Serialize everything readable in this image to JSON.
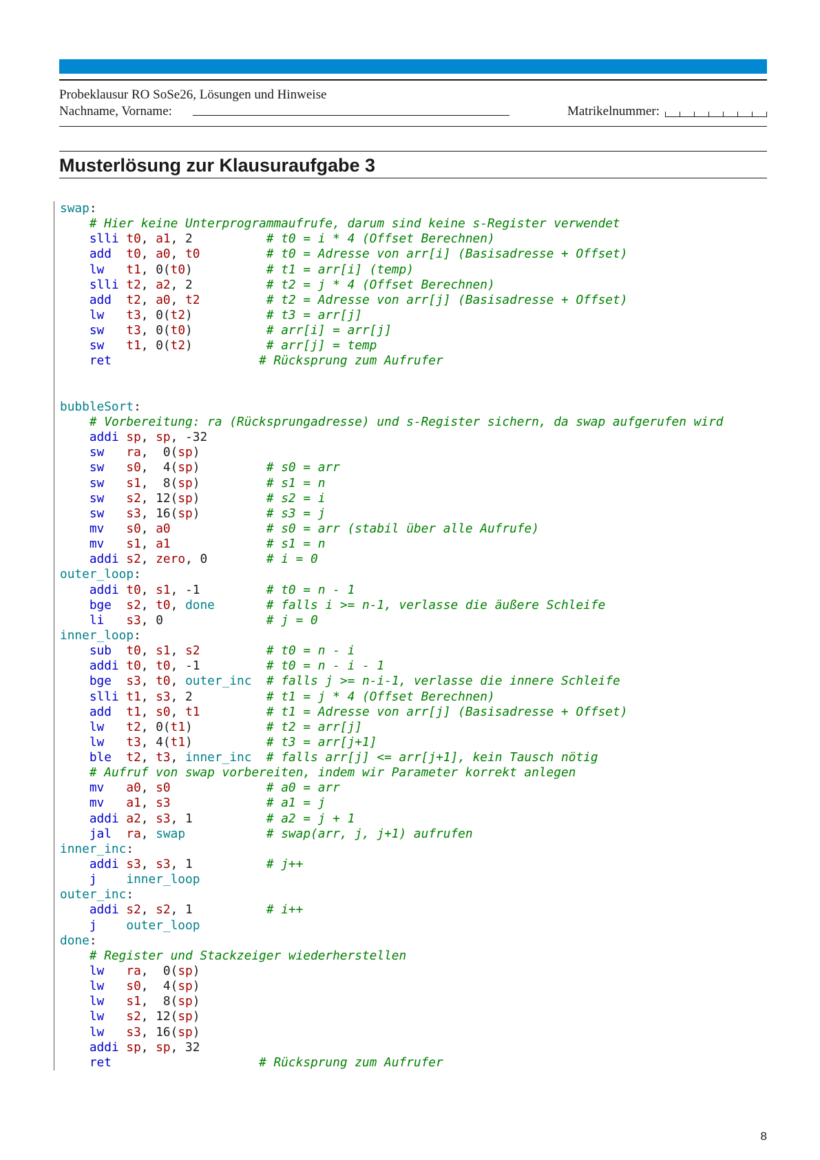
{
  "header": {
    "title": "Probeklausur RO SoSe26, Lösungen und Hinweise",
    "name_label": "Nachname, Vorname:",
    "matrikel_label": "Matrikelnummer:"
  },
  "section_title": "Musterlösung zur Klausuraufgabe 3",
  "page_number": "8",
  "colors": {
    "accent_bar": "#0288d1",
    "label": "#00808a",
    "instruction": "#0000cc",
    "register": "#a00000",
    "comment": "#008000"
  },
  "code_lines": [
    [
      [
        "l",
        "swap"
      ],
      [
        "p",
        ":"
      ]
    ],
    [
      [
        "p",
        "    "
      ],
      [
        "c",
        "# Hier keine Unterprogrammaufrufe, darum sind keine s-Register verwendet"
      ]
    ],
    [
      [
        "p",
        "    "
      ],
      [
        "i",
        "slli"
      ],
      [
        "p",
        " "
      ],
      [
        "r",
        "t0"
      ],
      [
        "p",
        ", "
      ],
      [
        "r",
        "a1"
      ],
      [
        "p",
        ", 2          "
      ],
      [
        "c",
        "# t0 = i * 4 (Offset Berechnen)"
      ]
    ],
    [
      [
        "p",
        "    "
      ],
      [
        "i",
        "add"
      ],
      [
        "p",
        "  "
      ],
      [
        "r",
        "t0"
      ],
      [
        "p",
        ", "
      ],
      [
        "r",
        "a0"
      ],
      [
        "p",
        ", "
      ],
      [
        "r",
        "t0"
      ],
      [
        "p",
        "         "
      ],
      [
        "c",
        "# t0 = Adresse von arr[i] (Basisadresse + Offset)"
      ]
    ],
    [
      [
        "p",
        "    "
      ],
      [
        "i",
        "lw"
      ],
      [
        "p",
        "   "
      ],
      [
        "r",
        "t1"
      ],
      [
        "p",
        ", 0("
      ],
      [
        "r",
        "t0"
      ],
      [
        "p",
        ")          "
      ],
      [
        "c",
        "# t1 = arr[i] (temp)"
      ]
    ],
    [
      [
        "p",
        "    "
      ],
      [
        "i",
        "slli"
      ],
      [
        "p",
        " "
      ],
      [
        "r",
        "t2"
      ],
      [
        "p",
        ", "
      ],
      [
        "r",
        "a2"
      ],
      [
        "p",
        ", 2          "
      ],
      [
        "c",
        "# t2 = j * 4 (Offset Berechnen)"
      ]
    ],
    [
      [
        "p",
        "    "
      ],
      [
        "i",
        "add"
      ],
      [
        "p",
        "  "
      ],
      [
        "r",
        "t2"
      ],
      [
        "p",
        ", "
      ],
      [
        "r",
        "a0"
      ],
      [
        "p",
        ", "
      ],
      [
        "r",
        "t2"
      ],
      [
        "p",
        "         "
      ],
      [
        "c",
        "# t2 = Adresse von arr[j] (Basisadresse + Offset)"
      ]
    ],
    [
      [
        "p",
        "    "
      ],
      [
        "i",
        "lw"
      ],
      [
        "p",
        "   "
      ],
      [
        "r",
        "t3"
      ],
      [
        "p",
        ", 0("
      ],
      [
        "r",
        "t2"
      ],
      [
        "p",
        ")          "
      ],
      [
        "c",
        "# t3 = arr[j]"
      ]
    ],
    [
      [
        "p",
        "    "
      ],
      [
        "i",
        "sw"
      ],
      [
        "p",
        "   "
      ],
      [
        "r",
        "t3"
      ],
      [
        "p",
        ", 0("
      ],
      [
        "r",
        "t0"
      ],
      [
        "p",
        ")          "
      ],
      [
        "c",
        "# arr[i] = arr[j]"
      ]
    ],
    [
      [
        "p",
        "    "
      ],
      [
        "i",
        "sw"
      ],
      [
        "p",
        "   "
      ],
      [
        "r",
        "t1"
      ],
      [
        "p",
        ", 0("
      ],
      [
        "r",
        "t2"
      ],
      [
        "p",
        ")          "
      ],
      [
        "c",
        "# arr[j] = temp"
      ]
    ],
    [
      [
        "p",
        "    "
      ],
      [
        "i",
        "ret"
      ],
      [
        "p",
        "                    "
      ],
      [
        "c",
        "# Rücksprung zum Aufrufer"
      ]
    ],
    [],
    [],
    [
      [
        "l",
        "bubbleSort"
      ],
      [
        "p",
        ":"
      ]
    ],
    [
      [
        "p",
        "    "
      ],
      [
        "c",
        "# Vorbereitung: ra (Rücksprungadresse) und s-Register sichern, da swap aufgerufen wird"
      ]
    ],
    [
      [
        "p",
        "    "
      ],
      [
        "i",
        "addi"
      ],
      [
        "p",
        " "
      ],
      [
        "r",
        "sp"
      ],
      [
        "p",
        ", "
      ],
      [
        "r",
        "sp"
      ],
      [
        "p",
        ", -32"
      ]
    ],
    [
      [
        "p",
        "    "
      ],
      [
        "i",
        "sw"
      ],
      [
        "p",
        "   "
      ],
      [
        "r",
        "ra"
      ],
      [
        "p",
        ",  0("
      ],
      [
        "r",
        "sp"
      ],
      [
        "p",
        ")"
      ]
    ],
    [
      [
        "p",
        "    "
      ],
      [
        "i",
        "sw"
      ],
      [
        "p",
        "   "
      ],
      [
        "r",
        "s0"
      ],
      [
        "p",
        ",  4("
      ],
      [
        "r",
        "sp"
      ],
      [
        "p",
        ")         "
      ],
      [
        "c",
        "# s0 = arr"
      ]
    ],
    [
      [
        "p",
        "    "
      ],
      [
        "i",
        "sw"
      ],
      [
        "p",
        "   "
      ],
      [
        "r",
        "s1"
      ],
      [
        "p",
        ",  8("
      ],
      [
        "r",
        "sp"
      ],
      [
        "p",
        ")         "
      ],
      [
        "c",
        "# s1 = n"
      ]
    ],
    [
      [
        "p",
        "    "
      ],
      [
        "i",
        "sw"
      ],
      [
        "p",
        "   "
      ],
      [
        "r",
        "s2"
      ],
      [
        "p",
        ", 12("
      ],
      [
        "r",
        "sp"
      ],
      [
        "p",
        ")         "
      ],
      [
        "c",
        "# s2 = i"
      ]
    ],
    [
      [
        "p",
        "    "
      ],
      [
        "i",
        "sw"
      ],
      [
        "p",
        "   "
      ],
      [
        "r",
        "s3"
      ],
      [
        "p",
        ", 16("
      ],
      [
        "r",
        "sp"
      ],
      [
        "p",
        ")         "
      ],
      [
        "c",
        "# s3 = j"
      ]
    ],
    [
      [
        "p",
        "    "
      ],
      [
        "i",
        "mv"
      ],
      [
        "p",
        "   "
      ],
      [
        "r",
        "s0"
      ],
      [
        "p",
        ", "
      ],
      [
        "r",
        "a0"
      ],
      [
        "p",
        "             "
      ],
      [
        "c",
        "# s0 = arr (stabil über alle Aufrufe)"
      ]
    ],
    [
      [
        "p",
        "    "
      ],
      [
        "i",
        "mv"
      ],
      [
        "p",
        "   "
      ],
      [
        "r",
        "s1"
      ],
      [
        "p",
        ", "
      ],
      [
        "r",
        "a1"
      ],
      [
        "p",
        "             "
      ],
      [
        "c",
        "# s1 = n"
      ]
    ],
    [
      [
        "p",
        "    "
      ],
      [
        "i",
        "addi"
      ],
      [
        "p",
        " "
      ],
      [
        "r",
        "s2"
      ],
      [
        "p",
        ", "
      ],
      [
        "r",
        "zero"
      ],
      [
        "p",
        ", 0        "
      ],
      [
        "c",
        "# i = 0"
      ]
    ],
    [
      [
        "l",
        "outer_loop"
      ],
      [
        "p",
        ":"
      ]
    ],
    [
      [
        "p",
        "    "
      ],
      [
        "i",
        "addi"
      ],
      [
        "p",
        " "
      ],
      [
        "r",
        "t0"
      ],
      [
        "p",
        ", "
      ],
      [
        "r",
        "s1"
      ],
      [
        "p",
        ", -1         "
      ],
      [
        "c",
        "# t0 = n - 1"
      ]
    ],
    [
      [
        "p",
        "    "
      ],
      [
        "i",
        "bge"
      ],
      [
        "p",
        "  "
      ],
      [
        "r",
        "s2"
      ],
      [
        "p",
        ", "
      ],
      [
        "r",
        "t0"
      ],
      [
        "p",
        ", "
      ],
      [
        "l",
        "done"
      ],
      [
        "p",
        "       "
      ],
      [
        "c",
        "# falls i >= n-1, verlasse die äußere Schleife"
      ]
    ],
    [
      [
        "p",
        "    "
      ],
      [
        "i",
        "li"
      ],
      [
        "p",
        "   "
      ],
      [
        "r",
        "s3"
      ],
      [
        "p",
        ", 0              "
      ],
      [
        "c",
        "# j = 0"
      ]
    ],
    [
      [
        "l",
        "inner_loop"
      ],
      [
        "p",
        ":"
      ]
    ],
    [
      [
        "p",
        "    "
      ],
      [
        "i",
        "sub"
      ],
      [
        "p",
        "  "
      ],
      [
        "r",
        "t0"
      ],
      [
        "p",
        ", "
      ],
      [
        "r",
        "s1"
      ],
      [
        "p",
        ", "
      ],
      [
        "r",
        "s2"
      ],
      [
        "p",
        "         "
      ],
      [
        "c",
        "# t0 = n - i"
      ]
    ],
    [
      [
        "p",
        "    "
      ],
      [
        "i",
        "addi"
      ],
      [
        "p",
        " "
      ],
      [
        "r",
        "t0"
      ],
      [
        "p",
        ", "
      ],
      [
        "r",
        "t0"
      ],
      [
        "p",
        ", -1         "
      ],
      [
        "c",
        "# t0 = n - i - 1"
      ]
    ],
    [
      [
        "p",
        "    "
      ],
      [
        "i",
        "bge"
      ],
      [
        "p",
        "  "
      ],
      [
        "r",
        "s3"
      ],
      [
        "p",
        ", "
      ],
      [
        "r",
        "t0"
      ],
      [
        "p",
        ", "
      ],
      [
        "l",
        "outer_inc"
      ],
      [
        "p",
        "  "
      ],
      [
        "c",
        "# falls j >= n-i-1, verlasse die innere Schleife"
      ]
    ],
    [
      [
        "p",
        "    "
      ],
      [
        "i",
        "slli"
      ],
      [
        "p",
        " "
      ],
      [
        "r",
        "t1"
      ],
      [
        "p",
        ", "
      ],
      [
        "r",
        "s3"
      ],
      [
        "p",
        ", 2          "
      ],
      [
        "c",
        "# t1 = j * 4 (Offset Berechnen)"
      ]
    ],
    [
      [
        "p",
        "    "
      ],
      [
        "i",
        "add"
      ],
      [
        "p",
        "  "
      ],
      [
        "r",
        "t1"
      ],
      [
        "p",
        ", "
      ],
      [
        "r",
        "s0"
      ],
      [
        "p",
        ", "
      ],
      [
        "r",
        "t1"
      ],
      [
        "p",
        "         "
      ],
      [
        "c",
        "# t1 = Adresse von arr[j] (Basisadresse + Offset)"
      ]
    ],
    [
      [
        "p",
        "    "
      ],
      [
        "i",
        "lw"
      ],
      [
        "p",
        "   "
      ],
      [
        "r",
        "t2"
      ],
      [
        "p",
        ", 0("
      ],
      [
        "r",
        "t1"
      ],
      [
        "p",
        ")          "
      ],
      [
        "c",
        "# t2 = arr[j]"
      ]
    ],
    [
      [
        "p",
        "    "
      ],
      [
        "i",
        "lw"
      ],
      [
        "p",
        "   "
      ],
      [
        "r",
        "t3"
      ],
      [
        "p",
        ", 4("
      ],
      [
        "r",
        "t1"
      ],
      [
        "p",
        ")          "
      ],
      [
        "c",
        "# t3 = arr[j+1]"
      ]
    ],
    [
      [
        "p",
        "    "
      ],
      [
        "i",
        "ble"
      ],
      [
        "p",
        "  "
      ],
      [
        "r",
        "t2"
      ],
      [
        "p",
        ", "
      ],
      [
        "r",
        "t3"
      ],
      [
        "p",
        ", "
      ],
      [
        "l",
        "inner_inc"
      ],
      [
        "p",
        "  "
      ],
      [
        "c",
        "# falls arr[j] <= arr[j+1], kein Tausch nötig"
      ]
    ],
    [
      [
        "p",
        "    "
      ],
      [
        "c",
        "# Aufruf von swap vorbereiten, indem wir Parameter korrekt anlegen"
      ]
    ],
    [
      [
        "p",
        "    "
      ],
      [
        "i",
        "mv"
      ],
      [
        "p",
        "   "
      ],
      [
        "r",
        "a0"
      ],
      [
        "p",
        ", "
      ],
      [
        "r",
        "s0"
      ],
      [
        "p",
        "             "
      ],
      [
        "c",
        "# a0 = arr"
      ]
    ],
    [
      [
        "p",
        "    "
      ],
      [
        "i",
        "mv"
      ],
      [
        "p",
        "   "
      ],
      [
        "r",
        "a1"
      ],
      [
        "p",
        ", "
      ],
      [
        "r",
        "s3"
      ],
      [
        "p",
        "             "
      ],
      [
        "c",
        "# a1 = j"
      ]
    ],
    [
      [
        "p",
        "    "
      ],
      [
        "i",
        "addi"
      ],
      [
        "p",
        " "
      ],
      [
        "r",
        "a2"
      ],
      [
        "p",
        ", "
      ],
      [
        "r",
        "s3"
      ],
      [
        "p",
        ", 1          "
      ],
      [
        "c",
        "# a2 = j + 1"
      ]
    ],
    [
      [
        "p",
        "    "
      ],
      [
        "i",
        "jal"
      ],
      [
        "p",
        "  "
      ],
      [
        "r",
        "ra"
      ],
      [
        "p",
        ", "
      ],
      [
        "l",
        "swap"
      ],
      [
        "p",
        "           "
      ],
      [
        "c",
        "# swap(arr, j, j+1) aufrufen"
      ]
    ],
    [
      [
        "l",
        "inner_inc"
      ],
      [
        "p",
        ":"
      ]
    ],
    [
      [
        "p",
        "    "
      ],
      [
        "i",
        "addi"
      ],
      [
        "p",
        " "
      ],
      [
        "r",
        "s3"
      ],
      [
        "p",
        ", "
      ],
      [
        "r",
        "s3"
      ],
      [
        "p",
        ", 1          "
      ],
      [
        "c",
        "# j++"
      ]
    ],
    [
      [
        "p",
        "    "
      ],
      [
        "i",
        "j"
      ],
      [
        "p",
        "    "
      ],
      [
        "l",
        "inner_loop"
      ]
    ],
    [
      [
        "l",
        "outer_inc"
      ],
      [
        "p",
        ":"
      ]
    ],
    [
      [
        "p",
        "    "
      ],
      [
        "i",
        "addi"
      ],
      [
        "p",
        " "
      ],
      [
        "r",
        "s2"
      ],
      [
        "p",
        ", "
      ],
      [
        "r",
        "s2"
      ],
      [
        "p",
        ", 1          "
      ],
      [
        "c",
        "# i++"
      ]
    ],
    [
      [
        "p",
        "    "
      ],
      [
        "i",
        "j"
      ],
      [
        "p",
        "    "
      ],
      [
        "l",
        "outer_loop"
      ]
    ],
    [
      [
        "l",
        "done"
      ],
      [
        "p",
        ":"
      ]
    ],
    [
      [
        "p",
        "    "
      ],
      [
        "c",
        "# Register und Stackzeiger wiederherstellen"
      ]
    ],
    [
      [
        "p",
        "    "
      ],
      [
        "i",
        "lw"
      ],
      [
        "p",
        "   "
      ],
      [
        "r",
        "ra"
      ],
      [
        "p",
        ",  0("
      ],
      [
        "r",
        "sp"
      ],
      [
        "p",
        ")"
      ]
    ],
    [
      [
        "p",
        "    "
      ],
      [
        "i",
        "lw"
      ],
      [
        "p",
        "   "
      ],
      [
        "r",
        "s0"
      ],
      [
        "p",
        ",  4("
      ],
      [
        "r",
        "sp"
      ],
      [
        "p",
        ")"
      ]
    ],
    [
      [
        "p",
        "    "
      ],
      [
        "i",
        "lw"
      ],
      [
        "p",
        "   "
      ],
      [
        "r",
        "s1"
      ],
      [
        "p",
        ",  8("
      ],
      [
        "r",
        "sp"
      ],
      [
        "p",
        ")"
      ]
    ],
    [
      [
        "p",
        "    "
      ],
      [
        "i",
        "lw"
      ],
      [
        "p",
        "   "
      ],
      [
        "r",
        "s2"
      ],
      [
        "p",
        ", 12("
      ],
      [
        "r",
        "sp"
      ],
      [
        "p",
        ")"
      ]
    ],
    [
      [
        "p",
        "    "
      ],
      [
        "i",
        "lw"
      ],
      [
        "p",
        "   "
      ],
      [
        "r",
        "s3"
      ],
      [
        "p",
        ", 16("
      ],
      [
        "r",
        "sp"
      ],
      [
        "p",
        ")"
      ]
    ],
    [
      [
        "p",
        "    "
      ],
      [
        "i",
        "addi"
      ],
      [
        "p",
        " "
      ],
      [
        "r",
        "sp"
      ],
      [
        "p",
        ", "
      ],
      [
        "r",
        "sp"
      ],
      [
        "p",
        ", 32"
      ]
    ],
    [
      [
        "p",
        "    "
      ],
      [
        "i",
        "ret"
      ],
      [
        "p",
        "                    "
      ],
      [
        "c",
        "# Rücksprung zum Aufrufer"
      ]
    ]
  ]
}
